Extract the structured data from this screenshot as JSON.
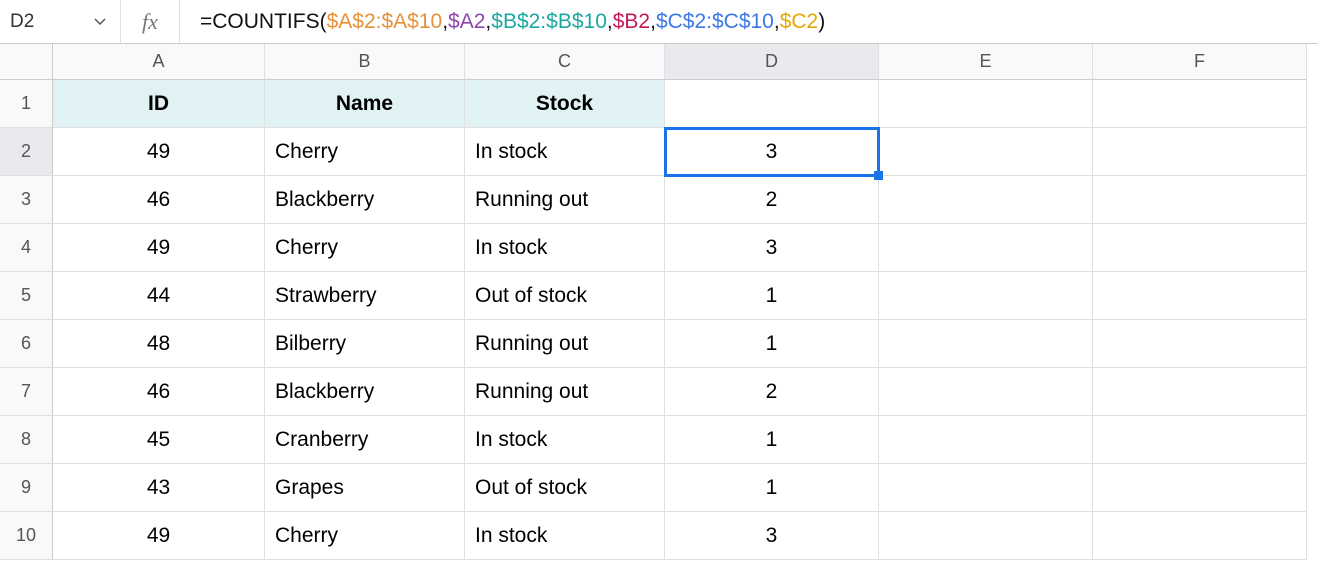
{
  "nameBox": "D2",
  "fxLabel": "fx",
  "formula": {
    "prefix": "=COUNTIFS(",
    "parts": [
      {
        "text": "$A$2:$A$10",
        "cls": "c1"
      },
      {
        "text": ",",
        "cls": "comma"
      },
      {
        "text": "$A2",
        "cls": "c2"
      },
      {
        "text": ",",
        "cls": "comma"
      },
      {
        "text": "$B$2:$B$10",
        "cls": "c3"
      },
      {
        "text": ",",
        "cls": "comma"
      },
      {
        "text": "$B2",
        "cls": "c4"
      },
      {
        "text": ",",
        "cls": "comma"
      },
      {
        "text": "$C$2:$C$10",
        "cls": "c5"
      },
      {
        "text": ",",
        "cls": "comma"
      },
      {
        "text": "$C2",
        "cls": "c6"
      }
    ],
    "suffix": ")"
  },
  "columns": [
    "A",
    "B",
    "C",
    "D",
    "E",
    "F"
  ],
  "activeCol": "D",
  "activeRow": 2,
  "headers": {
    "A": "ID",
    "B": "Name",
    "C": "Stock"
  },
  "rows": [
    {
      "n": 1,
      "A": "ID",
      "B": "Name",
      "C": "Stock",
      "D": "",
      "E": "",
      "F": "",
      "isHeader": true
    },
    {
      "n": 2,
      "A": "49",
      "B": "Cherry",
      "C": "In stock",
      "D": "3",
      "E": "",
      "F": ""
    },
    {
      "n": 3,
      "A": "46",
      "B": "Blackberry",
      "C": "Running out",
      "D": "2",
      "E": "",
      "F": ""
    },
    {
      "n": 4,
      "A": "49",
      "B": "Cherry",
      "C": "In stock",
      "D": "3",
      "E": "",
      "F": ""
    },
    {
      "n": 5,
      "A": "44",
      "B": "Strawberry",
      "C": "Out of stock",
      "D": "1",
      "E": "",
      "F": ""
    },
    {
      "n": 6,
      "A": "48",
      "B": "Bilberry",
      "C": "Running out",
      "D": "1",
      "E": "",
      "F": ""
    },
    {
      "n": 7,
      "A": "46",
      "B": "Blackberry",
      "C": "Running out",
      "D": "2",
      "E": "",
      "F": ""
    },
    {
      "n": 8,
      "A": "45",
      "B": "Cranberry",
      "C": "In stock",
      "D": "1",
      "E": "",
      "F": ""
    },
    {
      "n": 9,
      "A": "43",
      "B": "Grapes",
      "C": "Out of stock",
      "D": "1",
      "E": "",
      "F": ""
    },
    {
      "n": 10,
      "A": "49",
      "B": "Cherry",
      "C": "In stock",
      "D": "3",
      "E": "",
      "F": ""
    }
  ]
}
